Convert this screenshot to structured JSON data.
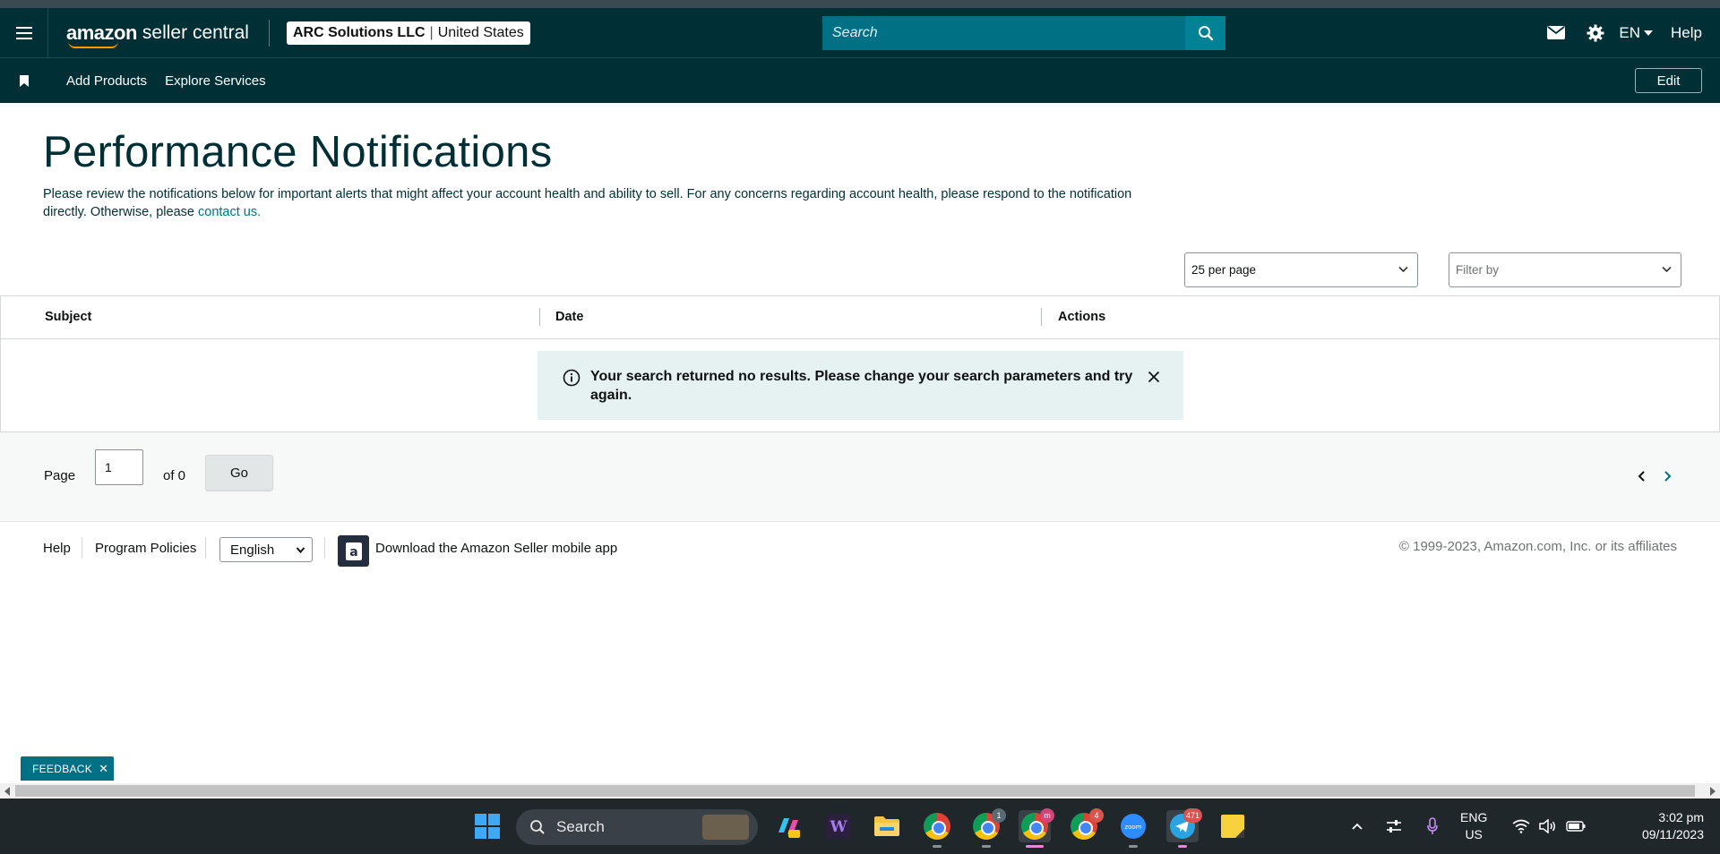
{
  "header": {
    "logo_brand": "amazon",
    "logo_product": "seller central",
    "account_name": "ARC Solutions LLC",
    "account_region": "United States",
    "search_placeholder": "Search",
    "language": "EN",
    "help": "Help"
  },
  "subnav": {
    "items": [
      "Add Products",
      "Explore Services"
    ],
    "edit": "Edit"
  },
  "page": {
    "title": "Performance Notifications",
    "description": "Please review the notifications below for important alerts that might affect your account health and ability to sell. For any concerns regarding account health, please respond to the notification directly. Otherwise, please",
    "contact_link": "contact us."
  },
  "controls": {
    "per_page": "25 per page",
    "filter_by": "Filter by"
  },
  "table": {
    "columns": [
      "Subject",
      "Date",
      "Actions"
    ],
    "empty_message": "Your search returned no results. Please change your search parameters and try again."
  },
  "pagination": {
    "page_label": "Page",
    "current_page": "1",
    "of_label": "of 0",
    "go": "Go"
  },
  "footer": {
    "help": "Help",
    "program_policies": "Program Policies",
    "language": "English",
    "download_app": "Download the Amazon Seller mobile app",
    "copyright": "© 1999-2023, Amazon.com, Inc. or its affiliates"
  },
  "feedback": {
    "label": "FEEDBACK"
  },
  "taskbar": {
    "search": "Search",
    "badges": {
      "chrome_2": "1",
      "chrome_3": "m",
      "chrome_4": "4",
      "telegram": "471"
    },
    "lang_top": "ENG",
    "lang_bottom": "US",
    "time": "3:02 pm",
    "date": "09/11/2023"
  },
  "colors": {
    "nav_bg": "#002f36",
    "search_bg": "#007185",
    "accent_orange": "#ff9900",
    "link": "#007185",
    "alert_bg": "#e6f1f2"
  }
}
